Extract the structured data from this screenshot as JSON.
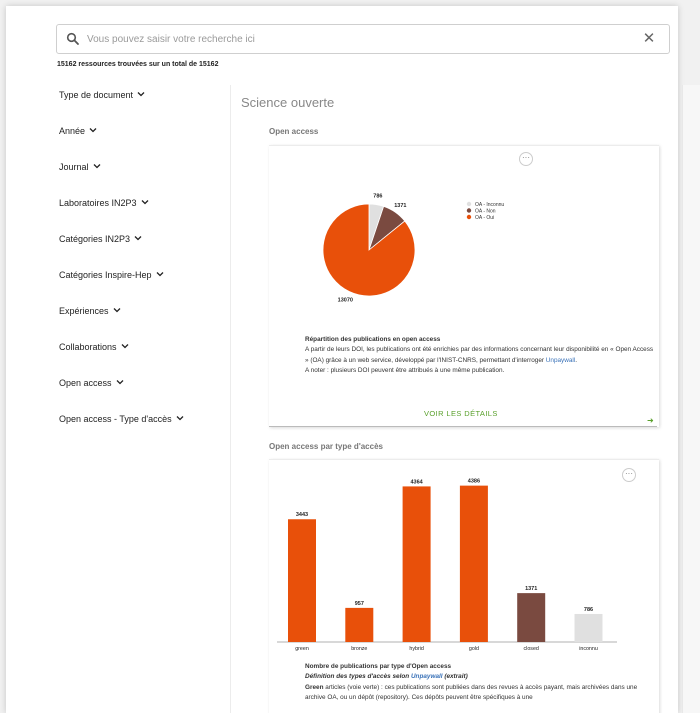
{
  "search": {
    "placeholder": "Vous pouvez saisir votre recherche ici",
    "value": ""
  },
  "results_summary": "15162 ressources trouvées sur un total de 15162",
  "facets": [
    {
      "label": "Type de document"
    },
    {
      "label": "Année"
    },
    {
      "label": "Journal"
    },
    {
      "label": "Laboratoires IN2P3"
    },
    {
      "label": "Catégories IN2P3"
    },
    {
      "label": "Catégories Inspire-Hep"
    },
    {
      "label": "Expériences"
    },
    {
      "label": "Collaborations"
    },
    {
      "label": "Open access"
    },
    {
      "label": "Open access - Type d'accès"
    }
  ],
  "main": {
    "section_title": "Science ouverte",
    "panel1": {
      "title": "Open access",
      "more_label": "···",
      "desc_title": "Répartition des publications en open access",
      "desc_p1a": "A partir de leurs DOI, les publications ont été enrichies par des informations concernant leur disponibilité en « Open Access » (OA) grâce à un web service, développé par l'INIST-CNRS, permettant d'interroger",
      "desc_link": "Unpaywall",
      "desc_p1b": ".",
      "desc_p2": "A noter : plusieurs DOI peuvent être attribués à une même publication.",
      "details_label": "VOIR LES DÉTAILS",
      "arrow_label": "➜"
    },
    "panel2": {
      "title": "Open access par type d'accès",
      "more_label": "···",
      "desc_title": "Nombre de publications par type d'Open access",
      "desc_def_a": "Définition des types d'accès selon ",
      "desc_def_link": "Unpaywall",
      "desc_def_b": " (extrait)",
      "desc_green_label": "Green",
      "desc_green_text": " articles (voie verte) : ces publications sont publiées dans des revues à accès payant, mais archivées dans une archive OA, ou un dépôt (repository). Ces dépôts peuvent être spécifiques à une"
    }
  },
  "colors": {
    "orange": "#e8500a",
    "brown": "#7a4a40",
    "grey": "#e0e0e0",
    "green": "#5aa02c",
    "link": "#3a72b8"
  },
  "chart_data": [
    {
      "type": "pie",
      "title": "",
      "labels": [
        "OA - Inconnu",
        "OA - Non",
        "OA - Oui"
      ],
      "values": [
        786,
        1371,
        13070
      ],
      "colors": [
        "#e0e0e0",
        "#7a4a40",
        "#e8500a"
      ],
      "legend": "right"
    },
    {
      "type": "bar",
      "title": "",
      "categories": [
        "green",
        "bronze",
        "hybrid",
        "gold",
        "closed",
        "inconnu"
      ],
      "values": [
        3443,
        957,
        4364,
        4386,
        1371,
        786
      ],
      "colors": [
        "#e8500a",
        "#e8500a",
        "#e8500a",
        "#e8500a",
        "#7a4a40",
        "#e0e0e0"
      ],
      "xlabel": "",
      "ylabel": ""
    }
  ]
}
